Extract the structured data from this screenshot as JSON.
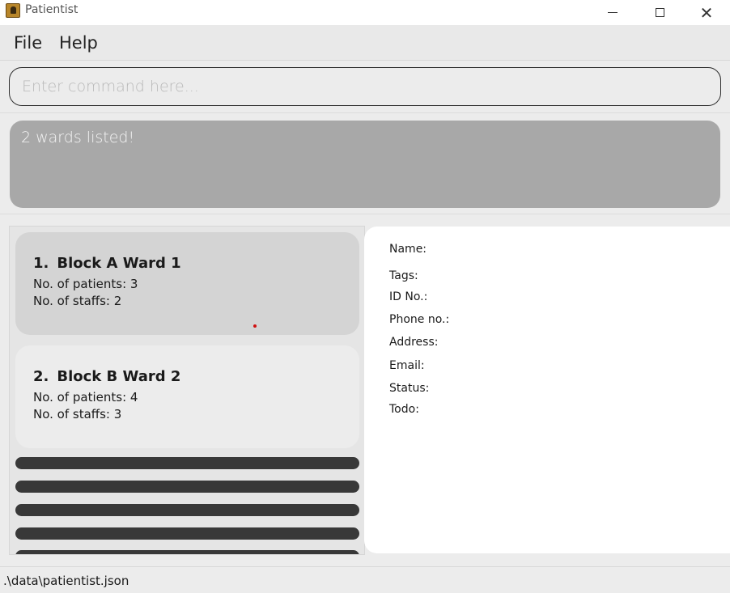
{
  "window": {
    "title": "Patientist",
    "controls": {
      "minimize": "minimize-icon",
      "maximize": "maximize-icon",
      "close": "close-icon"
    }
  },
  "menu": {
    "file": "File",
    "help": "Help"
  },
  "command": {
    "placeholder": "Enter command here...",
    "value": ""
  },
  "result": {
    "message": "2 wards listed!"
  },
  "wards": [
    {
      "index": "1.",
      "name": "Block A Ward 1",
      "patients": "No. of patients: 3",
      "staffs": "No. of staffs: 2",
      "selected": true
    },
    {
      "index": "2.",
      "name": "Block B Ward 2",
      "patients": "No. of patients: 4",
      "staffs": "No. of staffs: 3",
      "selected": false
    }
  ],
  "details": {
    "name": "Name:",
    "tags": "Tags:",
    "id": "ID No.:",
    "phone": "Phone no.:",
    "address": "Address:",
    "email": "Email:",
    "status": "Status:",
    "todo": "Todo:"
  },
  "statusbar": {
    "path": ".\\data\\patientist.json"
  },
  "colors": {
    "result_bg": "#a8a8a8",
    "selected_card": "#d4d4d4",
    "placeholder_bar": "#383838"
  }
}
